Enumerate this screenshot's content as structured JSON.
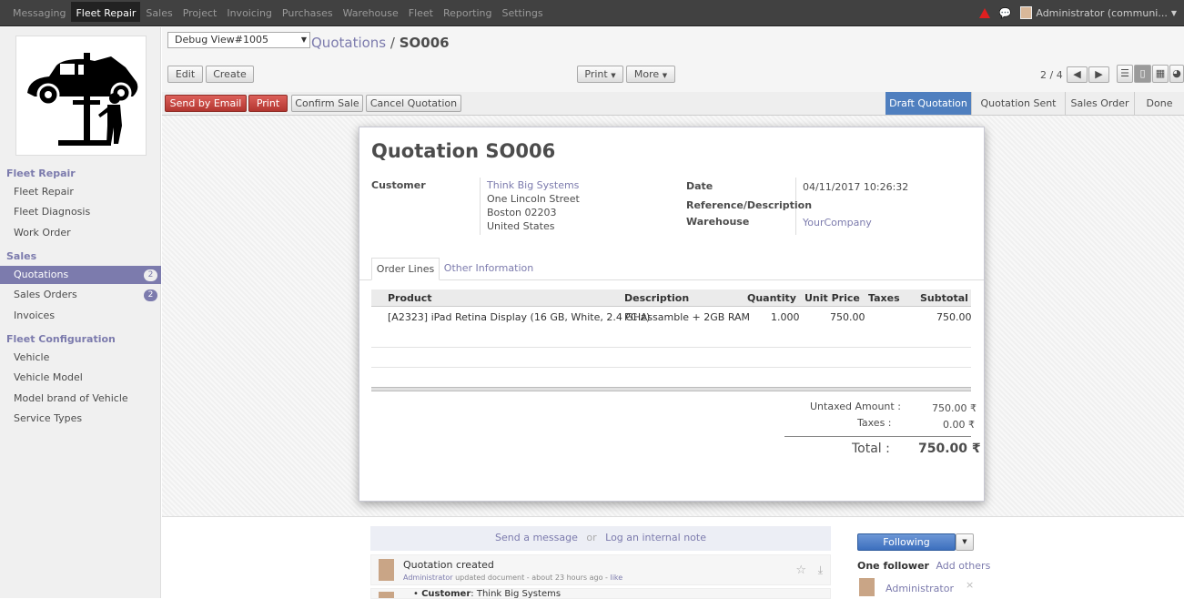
{
  "topnav": {
    "items": [
      "Messaging",
      "Fleet Repair",
      "Sales",
      "Project",
      "Invoicing",
      "Purchases",
      "Warehouse",
      "Fleet",
      "Reporting",
      "Settings"
    ],
    "active_index": 1,
    "user": "Administrator (communi..."
  },
  "sidebar": {
    "sections": [
      {
        "title": "Fleet Repair",
        "items": [
          {
            "label": "Fleet Repair"
          },
          {
            "label": "Fleet Diagnosis"
          },
          {
            "label": "Work Order"
          }
        ]
      },
      {
        "title": "Sales",
        "items": [
          {
            "label": "Quotations",
            "badge": "2",
            "selected": true
          },
          {
            "label": "Sales Orders",
            "badge": "2"
          },
          {
            "label": "Invoices"
          }
        ]
      },
      {
        "title": "Fleet Configuration",
        "items": [
          {
            "label": "Vehicle"
          },
          {
            "label": "Vehicle Model"
          },
          {
            "label": "Model brand of Vehicle"
          },
          {
            "label": "Service Types"
          }
        ]
      }
    ]
  },
  "header": {
    "debug_select": "Debug View#1005",
    "breadcrumb_parent": "Quotations",
    "breadcrumb_sep": "/",
    "breadcrumb_current": "SO006",
    "edit": "Edit",
    "create": "Create",
    "print": "Print",
    "more": "More",
    "pager": "2 / 4"
  },
  "actions": {
    "send_email": "Send by Email",
    "print": "Print",
    "confirm": "Confirm Sale",
    "cancel": "Cancel Quotation"
  },
  "stages": [
    "Draft Quotation",
    "Quotation Sent",
    "Sales Order",
    "Done"
  ],
  "current_stage": 0,
  "form": {
    "title": "Quotation SO006",
    "customer_label": "Customer",
    "customer_name": "Think Big Systems",
    "address": [
      "One Lincoln Street",
      "Boston 02203",
      "United States"
    ],
    "date_label": "Date",
    "date_value": "04/11/2017 10:26:32",
    "reference_label": "Reference/Description",
    "warehouse_label": "Warehouse",
    "warehouse_value": "YourCompany",
    "tabs": [
      "Order Lines",
      "Other Information"
    ],
    "columns": [
      "Product",
      "Description",
      "Quantity",
      "Unit Price",
      "Taxes",
      "Subtotal"
    ],
    "lines": [
      {
        "product": "[A2323] iPad Retina Display (16 GB, White, 2.4 GHz)",
        "description": "PC Assamble + 2GB RAM",
        "quantity": "1.000",
        "unit_price": "750.00",
        "taxes": "",
        "subtotal": "750.00"
      }
    ],
    "untaxed_label": "Untaxed Amount :",
    "untaxed_value": "750.00 ₹",
    "taxes_label": "Taxes :",
    "taxes_value": "0.00 ₹",
    "total_label": "Total :",
    "total_value": "750.00 ₹"
  },
  "chatter": {
    "send_message": "Send a message",
    "or": "or",
    "log_note": "Log an internal note",
    "following": "Following",
    "followers_label": "One follower",
    "add_others": "Add others",
    "follower_name": "Administrator",
    "message1_title": "Quotation created",
    "message1_author": "Administrator",
    "message1_meta": "updated document - about 23 hours ago -",
    "message1_like": "like",
    "message2_label": "Customer",
    "message2_value": "Think Big Systems"
  },
  "colors": {
    "brand": "#7c7bad",
    "topbar": "#414141",
    "stage_active": "#4f7fbf",
    "danger": "#c0403a"
  }
}
